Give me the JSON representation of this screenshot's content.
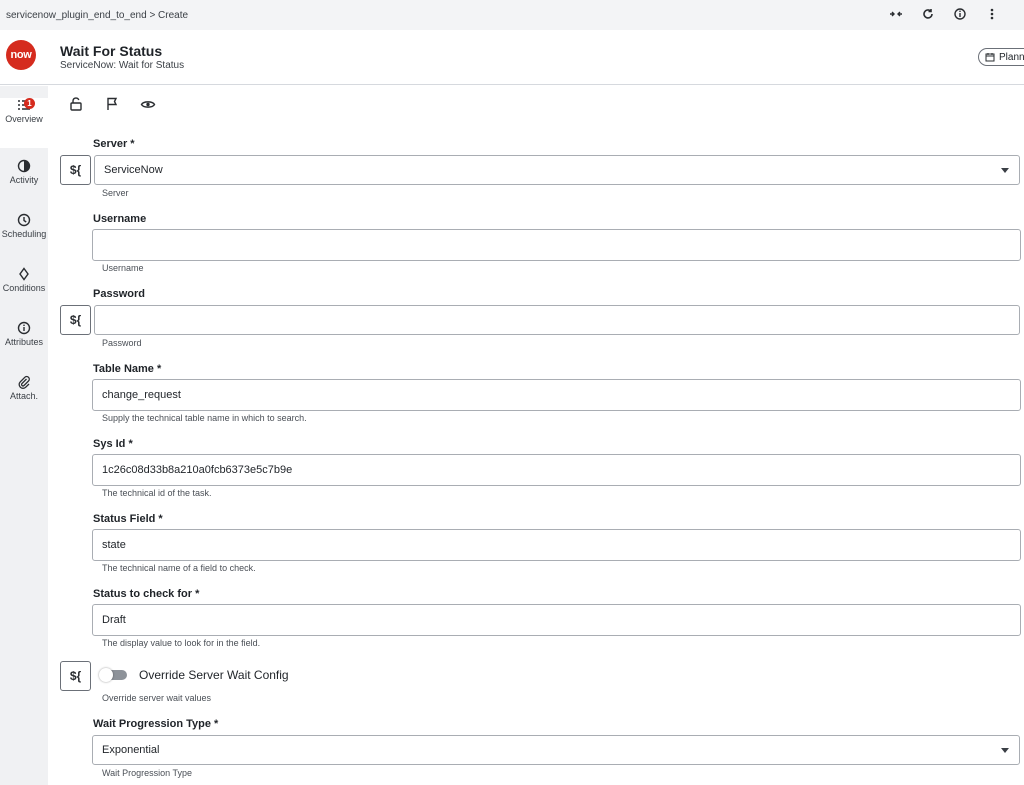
{
  "topbar": {
    "breadcrumb": "servicenow_plugin_end_to_end  >  Create",
    "icons": [
      "collapse-arrows-icon",
      "refresh-icon",
      "info-icon",
      "more-vertical-icon"
    ]
  },
  "header": {
    "logo_text": "now",
    "title": "Wait For Status",
    "subtitle": "ServiceNow: Wait for Status",
    "plan_button_label": "Plann"
  },
  "sidebar": {
    "items": [
      {
        "label": "Overview",
        "icon": "list-icon",
        "badge": "1"
      },
      {
        "label": "Activity",
        "icon": "activity-icon"
      },
      {
        "label": "Scheduling",
        "icon": "clock-icon"
      },
      {
        "label": "Conditions",
        "icon": "diamond-icon"
      },
      {
        "label": "Attributes",
        "icon": "info-icon"
      },
      {
        "label": "Attach.",
        "icon": "paperclip-icon"
      }
    ]
  },
  "toolbar": {
    "icons": [
      "unlock-icon",
      "flag-icon",
      "eye-icon"
    ]
  },
  "form": {
    "variable_button_label": "${",
    "server": {
      "label": "Server *",
      "value": "ServiceNow",
      "help": "Server"
    },
    "username": {
      "label": "Username",
      "value": "",
      "help": "Username"
    },
    "password": {
      "label": "Password",
      "value": "",
      "help": "Password"
    },
    "table_name": {
      "label": "Table Name *",
      "value": "change_request",
      "help": "Supply the technical table name in which to search."
    },
    "sys_id": {
      "label": "Sys Id *",
      "value": "1c26c08d33b8a210a0fcb6373e5c7b9e",
      "help": "The technical id of the task."
    },
    "status_field": {
      "label": "Status Field *",
      "value": "state",
      "help": "The technical name of a field to check."
    },
    "status_to_check": {
      "label": "Status to check for *",
      "value": "Draft",
      "help": "The display value to look for in the field."
    },
    "override": {
      "label": "Override Server Wait Config",
      "help": "Override server wait values",
      "enabled": false
    },
    "wait_progression": {
      "label": "Wait Progression Type *",
      "value": "Exponential",
      "help": "Wait Progression Type"
    }
  },
  "colors": {
    "accent": "#d52b1e",
    "sidebar_bg": "#f0f1f3",
    "border": "#a9adb3"
  }
}
